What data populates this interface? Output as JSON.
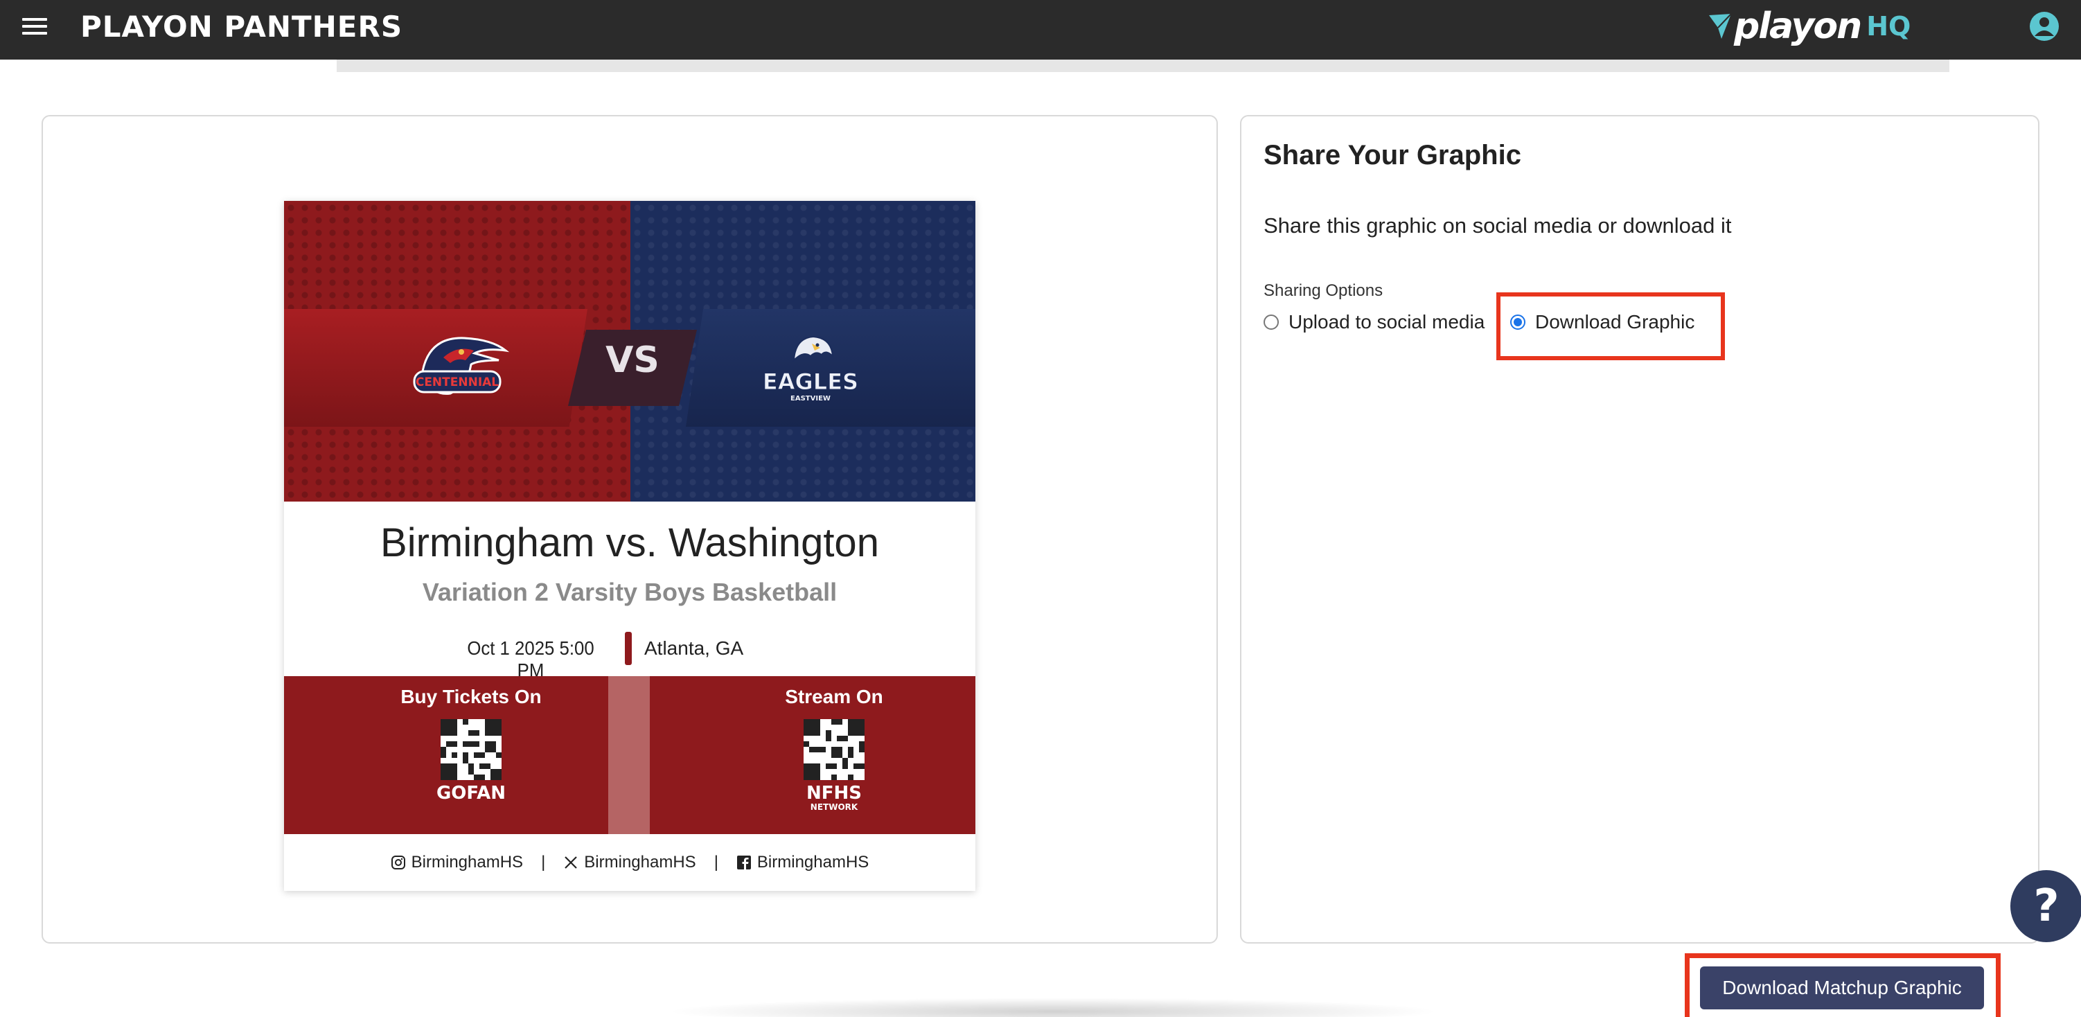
{
  "header": {
    "site_title": "PLAYON PANTHERS",
    "brand_name": "playon",
    "brand_suffix": "HQ",
    "brand_accent": "#5bc6d0"
  },
  "graphic": {
    "home_team_logo_text": "CENTENNIAL",
    "away_team_logo_text": "EAGLES",
    "away_team_logo_subtext": "EASTVIEW",
    "vs_label": "VS",
    "matchup_title": "Birmingham vs. Washington",
    "event_subtitle": "Variation 2 Varsity Boys Basketball",
    "datetime": "Oct 1 2025 5:00 PM",
    "location": "Atlanta, GA",
    "tickets_label": "Buy Tickets On",
    "tickets_brand": "GOFAN",
    "stream_label": "Stream On",
    "stream_brand": "NFHS",
    "stream_brand_sub": "NETWORK",
    "socials": [
      {
        "network": "instagram",
        "handle": "BirminghamHS"
      },
      {
        "network": "x",
        "handle": "BirminghamHS"
      },
      {
        "network": "facebook",
        "handle": "BirminghamHS"
      }
    ],
    "separator": "|",
    "colors": {
      "home": "#8e1a1d",
      "away": "#1c2d5c"
    }
  },
  "share": {
    "title": "Share Your Graphic",
    "description": "Share this graphic on social media or download it",
    "options_label": "Sharing Options",
    "options": [
      {
        "label": "Upload to social media",
        "selected": false
      },
      {
        "label": "Download Graphic",
        "selected": true
      }
    ]
  },
  "help_label": "?",
  "download_button_label": "Download Matchup Graphic",
  "highlight_color": "#e8351d"
}
